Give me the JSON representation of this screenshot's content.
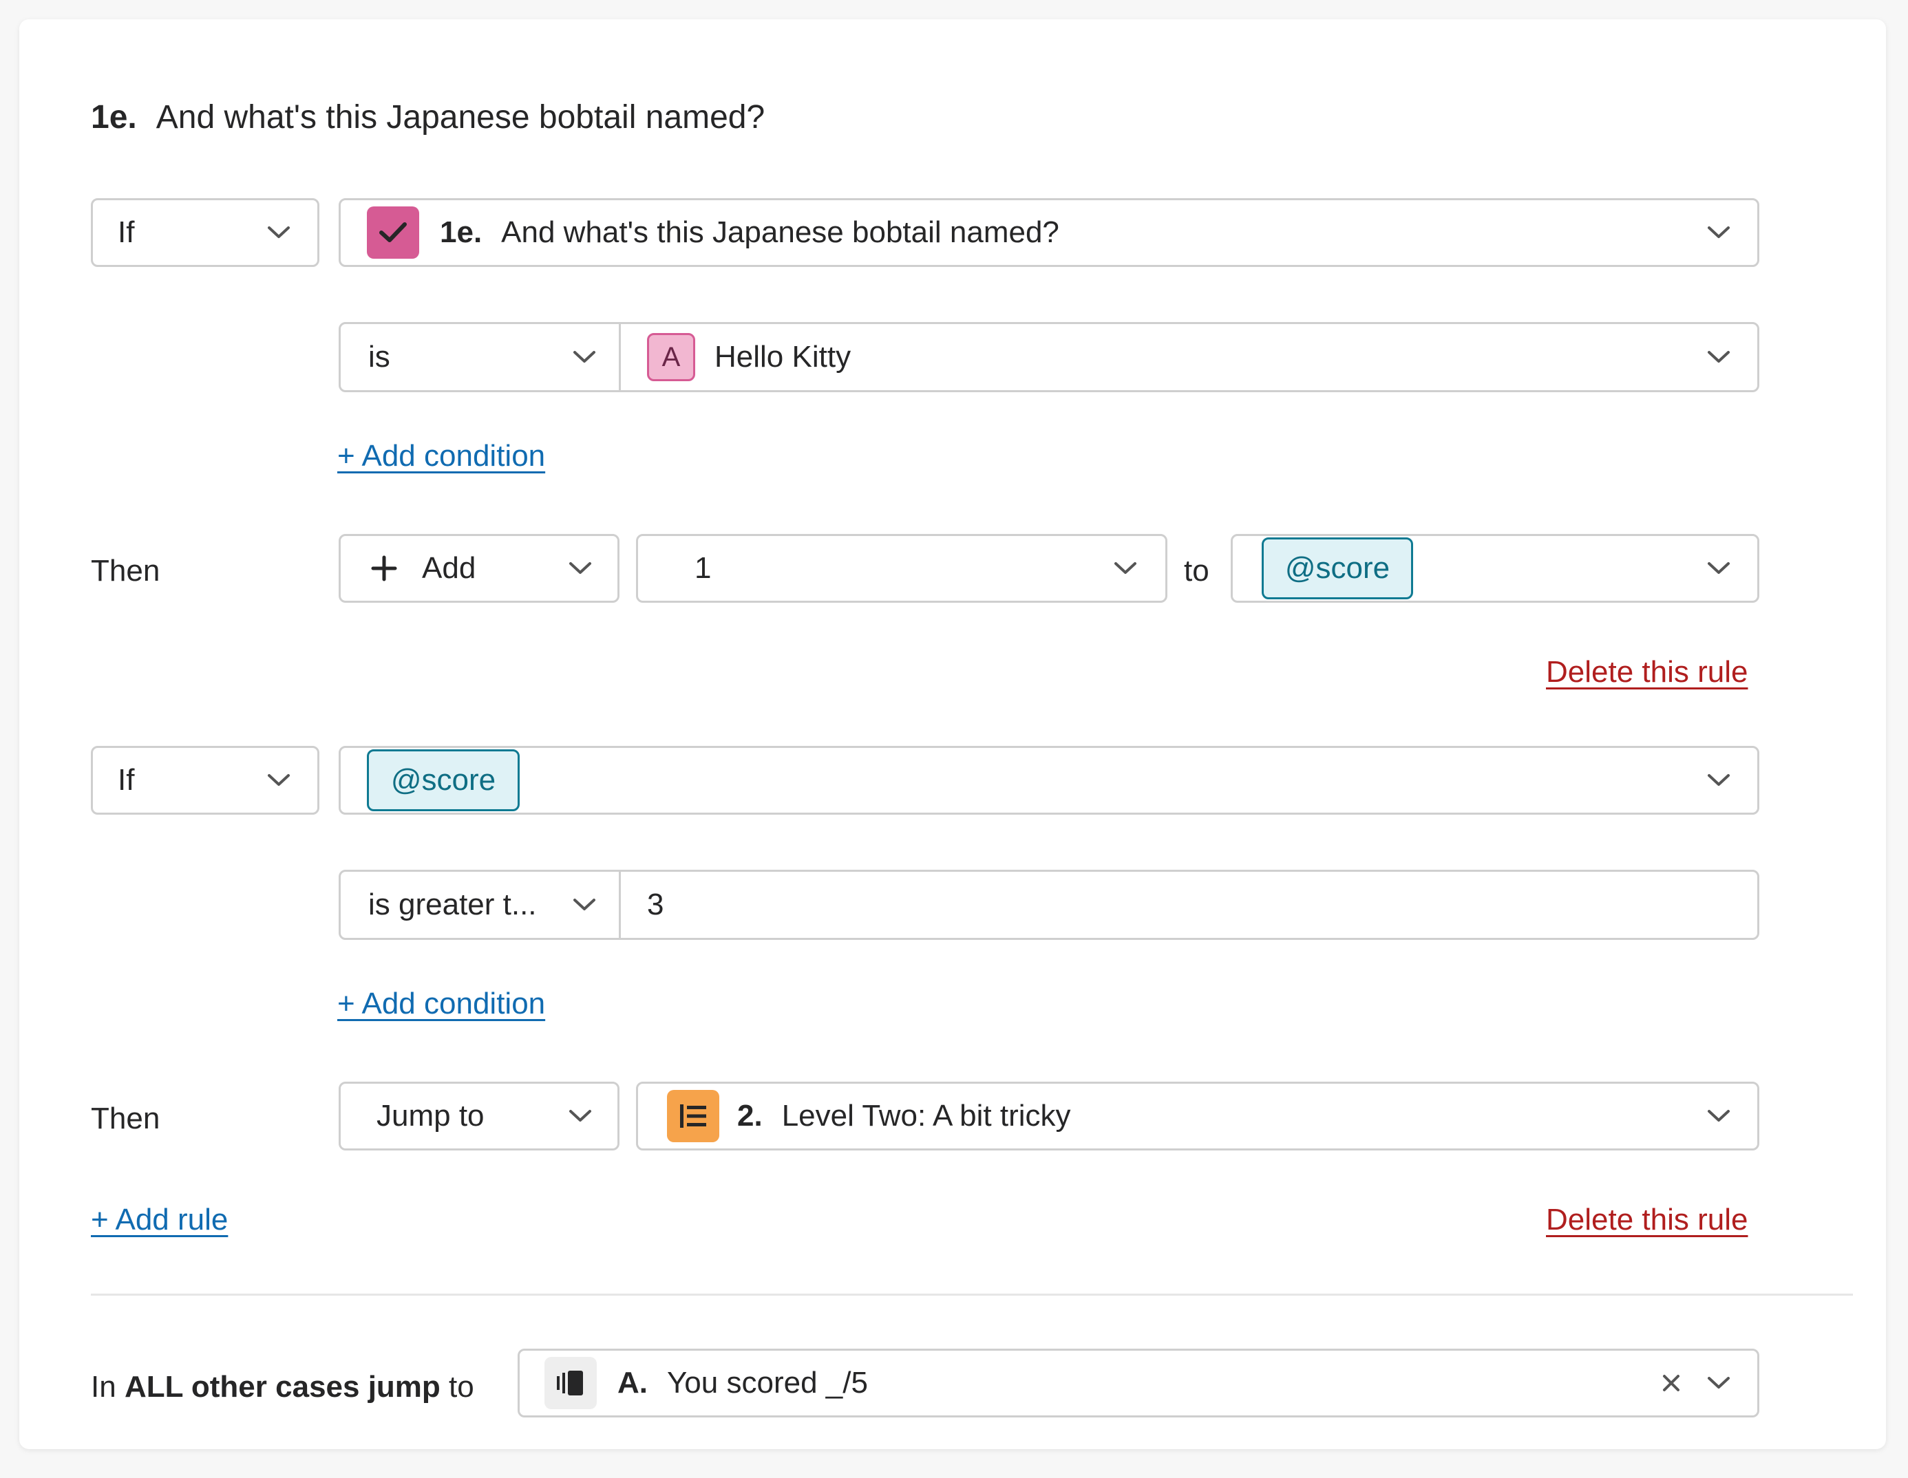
{
  "question": {
    "number": "1e.",
    "text": "And what's this Japanese bobtail named?"
  },
  "rules": [
    {
      "if_label": "If",
      "subject": {
        "number": "1e.",
        "text": "And what's this Japanese bobtail named?",
        "icon": "checkmark-icon",
        "icon_color": "#d65b94"
      },
      "operator": "is",
      "value": {
        "badge": "A",
        "text": "Hello Kitty"
      },
      "add_condition": "+ Add condition",
      "then_label": "Then",
      "action": "Add",
      "amount": "1",
      "to_label": "to",
      "target": "@score",
      "delete": "Delete this rule"
    },
    {
      "if_label": "If",
      "subject": {
        "tag": "@score"
      },
      "operator": "is greater t...",
      "value": "3",
      "add_condition": "+ Add condition",
      "then_label": "Then",
      "action": "Jump to",
      "destination": {
        "number": "2.",
        "text": "Level Two: A bit tricky",
        "icon": "list-icon",
        "icon_color": "#f6a34b"
      },
      "delete": "Delete this rule"
    }
  ],
  "add_rule": "+ Add rule",
  "fallback": {
    "prefix": "In",
    "bold": "ALL other cases jump to",
    "suffix": "to",
    "bold_main": "ALL other cases jump",
    "destination": {
      "number": "A.",
      "text": "You scored _/5",
      "icon": "ending-icon"
    }
  },
  "colors": {
    "link": "#106bb1",
    "delete": "#b01e1e",
    "tag_border": "#0f7a92",
    "tag_bg": "#dff2f6"
  }
}
